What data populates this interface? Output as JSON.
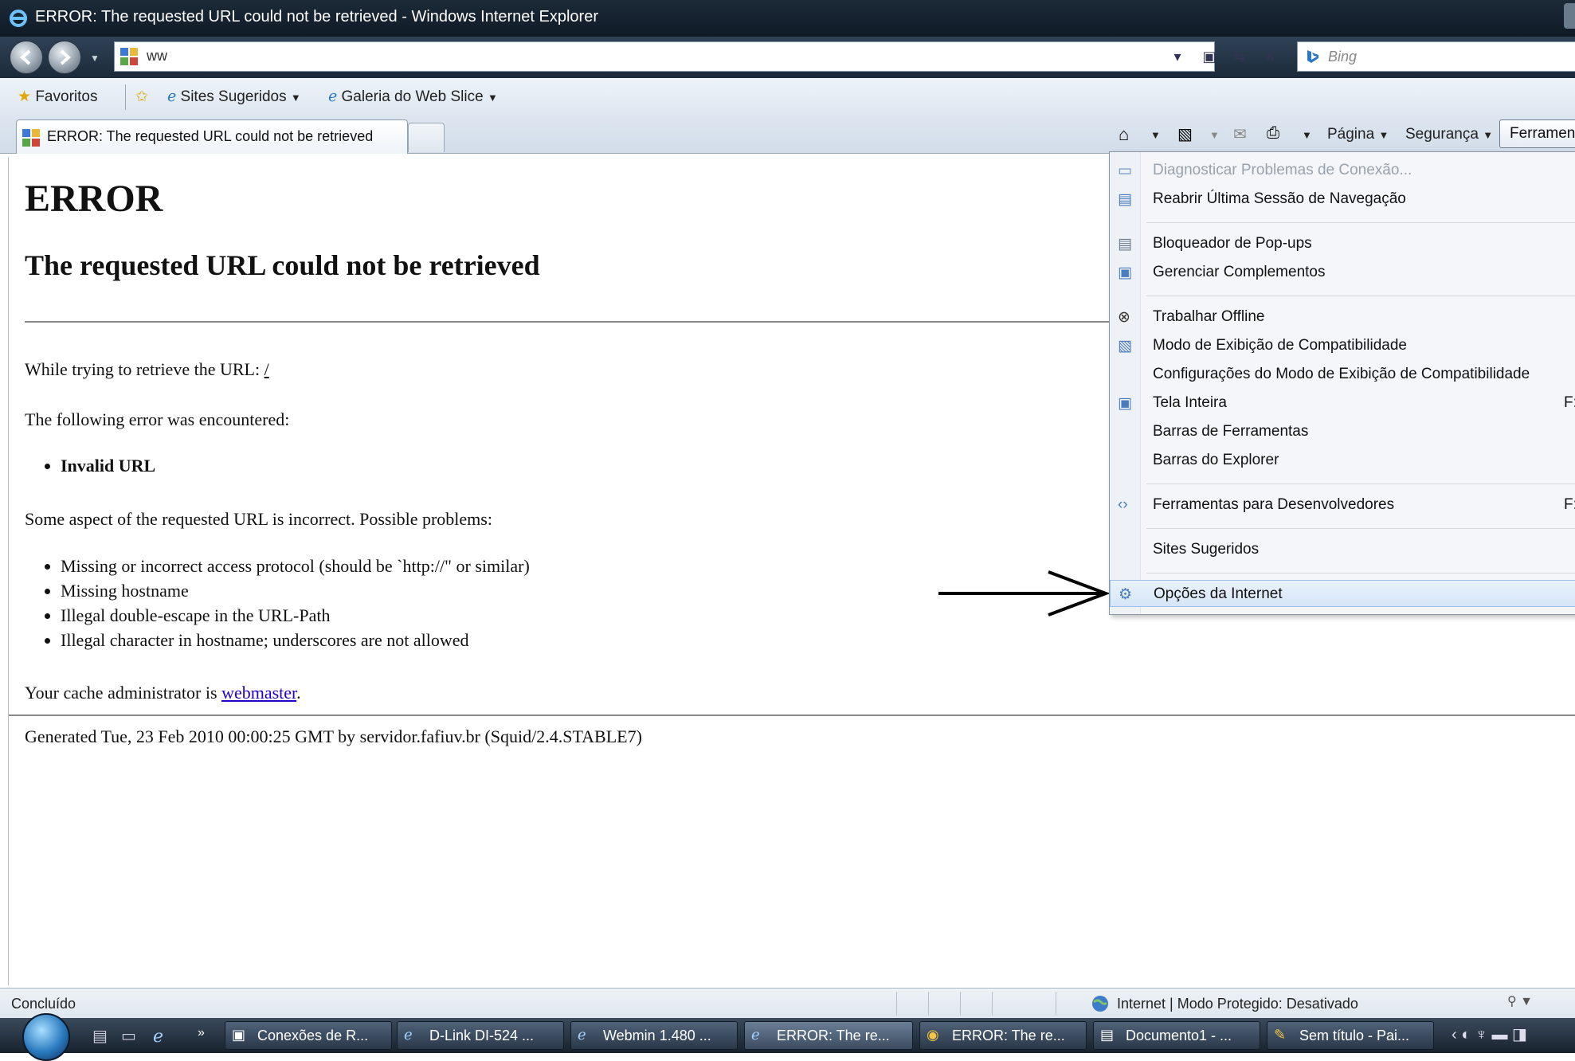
{
  "window": {
    "title": "ERROR: The requested URL could not be retrieved - Windows Internet Explorer"
  },
  "address_bar": {
    "url": "ww"
  },
  "search": {
    "placeholder": "Bing"
  },
  "favorites_bar": {
    "favorites_label": "Favoritos",
    "suggested_sites_label": "Sites Sugeridos",
    "web_slice_label": "Galeria do Web Slice"
  },
  "tab": {
    "title": "ERROR: The requested URL could not be retrieved"
  },
  "command_bar": {
    "page_label": "Página",
    "security_label": "Segurança",
    "tools_label": "Ferramentas"
  },
  "page": {
    "heading": "ERROR",
    "subheading": "The requested URL could not be retrieved",
    "retrieve_text": "While trying to retrieve the URL: ",
    "retrieve_url": "/",
    "error_intro": "The following error was encountered:",
    "error_name": "Invalid URL",
    "problems_intro": "Some aspect of the requested URL is incorrect. Possible problems:",
    "problems": [
      "Missing or incorrect access protocol (should be `http://\" or similar)",
      "Missing hostname",
      "Illegal double-escape in the URL-Path",
      "Illegal character in hostname; underscores are not allowed"
    ],
    "admin_text": "Your cache administrator is ",
    "admin_link": "webmaster",
    "admin_end": ".",
    "generated": "Generated Tue, 23 Feb 2010 00:00:25 GMT by servidor.fafiuv.br (Squid/2.4.STABLE7)"
  },
  "tools_menu": {
    "items": [
      {
        "label": "Diagnosticar Problemas de Conexão...",
        "icon": "network-diagnose-icon",
        "disabled": true
      },
      {
        "label": "Reabrir Última Sessão de Navegação",
        "icon": "reopen-session-icon"
      },
      {
        "label": "Bloqueador de Pop-ups",
        "icon": "popup-blocker-icon"
      },
      {
        "label": "Gerenciar Complementos",
        "icon": "addons-icon"
      },
      {
        "label": "Trabalhar Offline",
        "icon": "offline-icon"
      },
      {
        "label": "Modo de Exibição de Compatibilidade",
        "icon": "compatibility-icon"
      },
      {
        "label": "Configurações do Modo de Exibição de Compatibilidade"
      },
      {
        "label": "Tela Inteira",
        "icon": "fullscreen-icon",
        "shortcut": "F:"
      },
      {
        "label": "Barras de Ferramentas"
      },
      {
        "label": "Barras do Explorer"
      },
      {
        "label": "Ferramentas para Desenvolvedores",
        "icon": "developer-tools-icon",
        "shortcut": "F:"
      },
      {
        "label": "Sites Sugeridos"
      },
      {
        "label": "Opções da Internet",
        "icon": "internet-options-icon",
        "highlighted": true
      }
    ]
  },
  "status_bar": {
    "status": "Concluído",
    "zone": "Internet | Modo Protegido: Desativado"
  },
  "taskbar": {
    "buttons": [
      {
        "label": "Conexões de R...",
        "icon": "network-connections-icon"
      },
      {
        "label": "D-Link DI-524 ...",
        "icon": "ie-icon"
      },
      {
        "label": "Webmin 1.480 ...",
        "icon": "ie-icon"
      },
      {
        "label": "ERROR: The re...",
        "icon": "ie-icon",
        "active": true
      },
      {
        "label": "ERROR: The re...",
        "icon": "chrome-icon"
      },
      {
        "label": "Documento1 - ...",
        "icon": "word-icon"
      },
      {
        "label": "Sem título - Pai...",
        "icon": "paint-icon"
      }
    ]
  }
}
